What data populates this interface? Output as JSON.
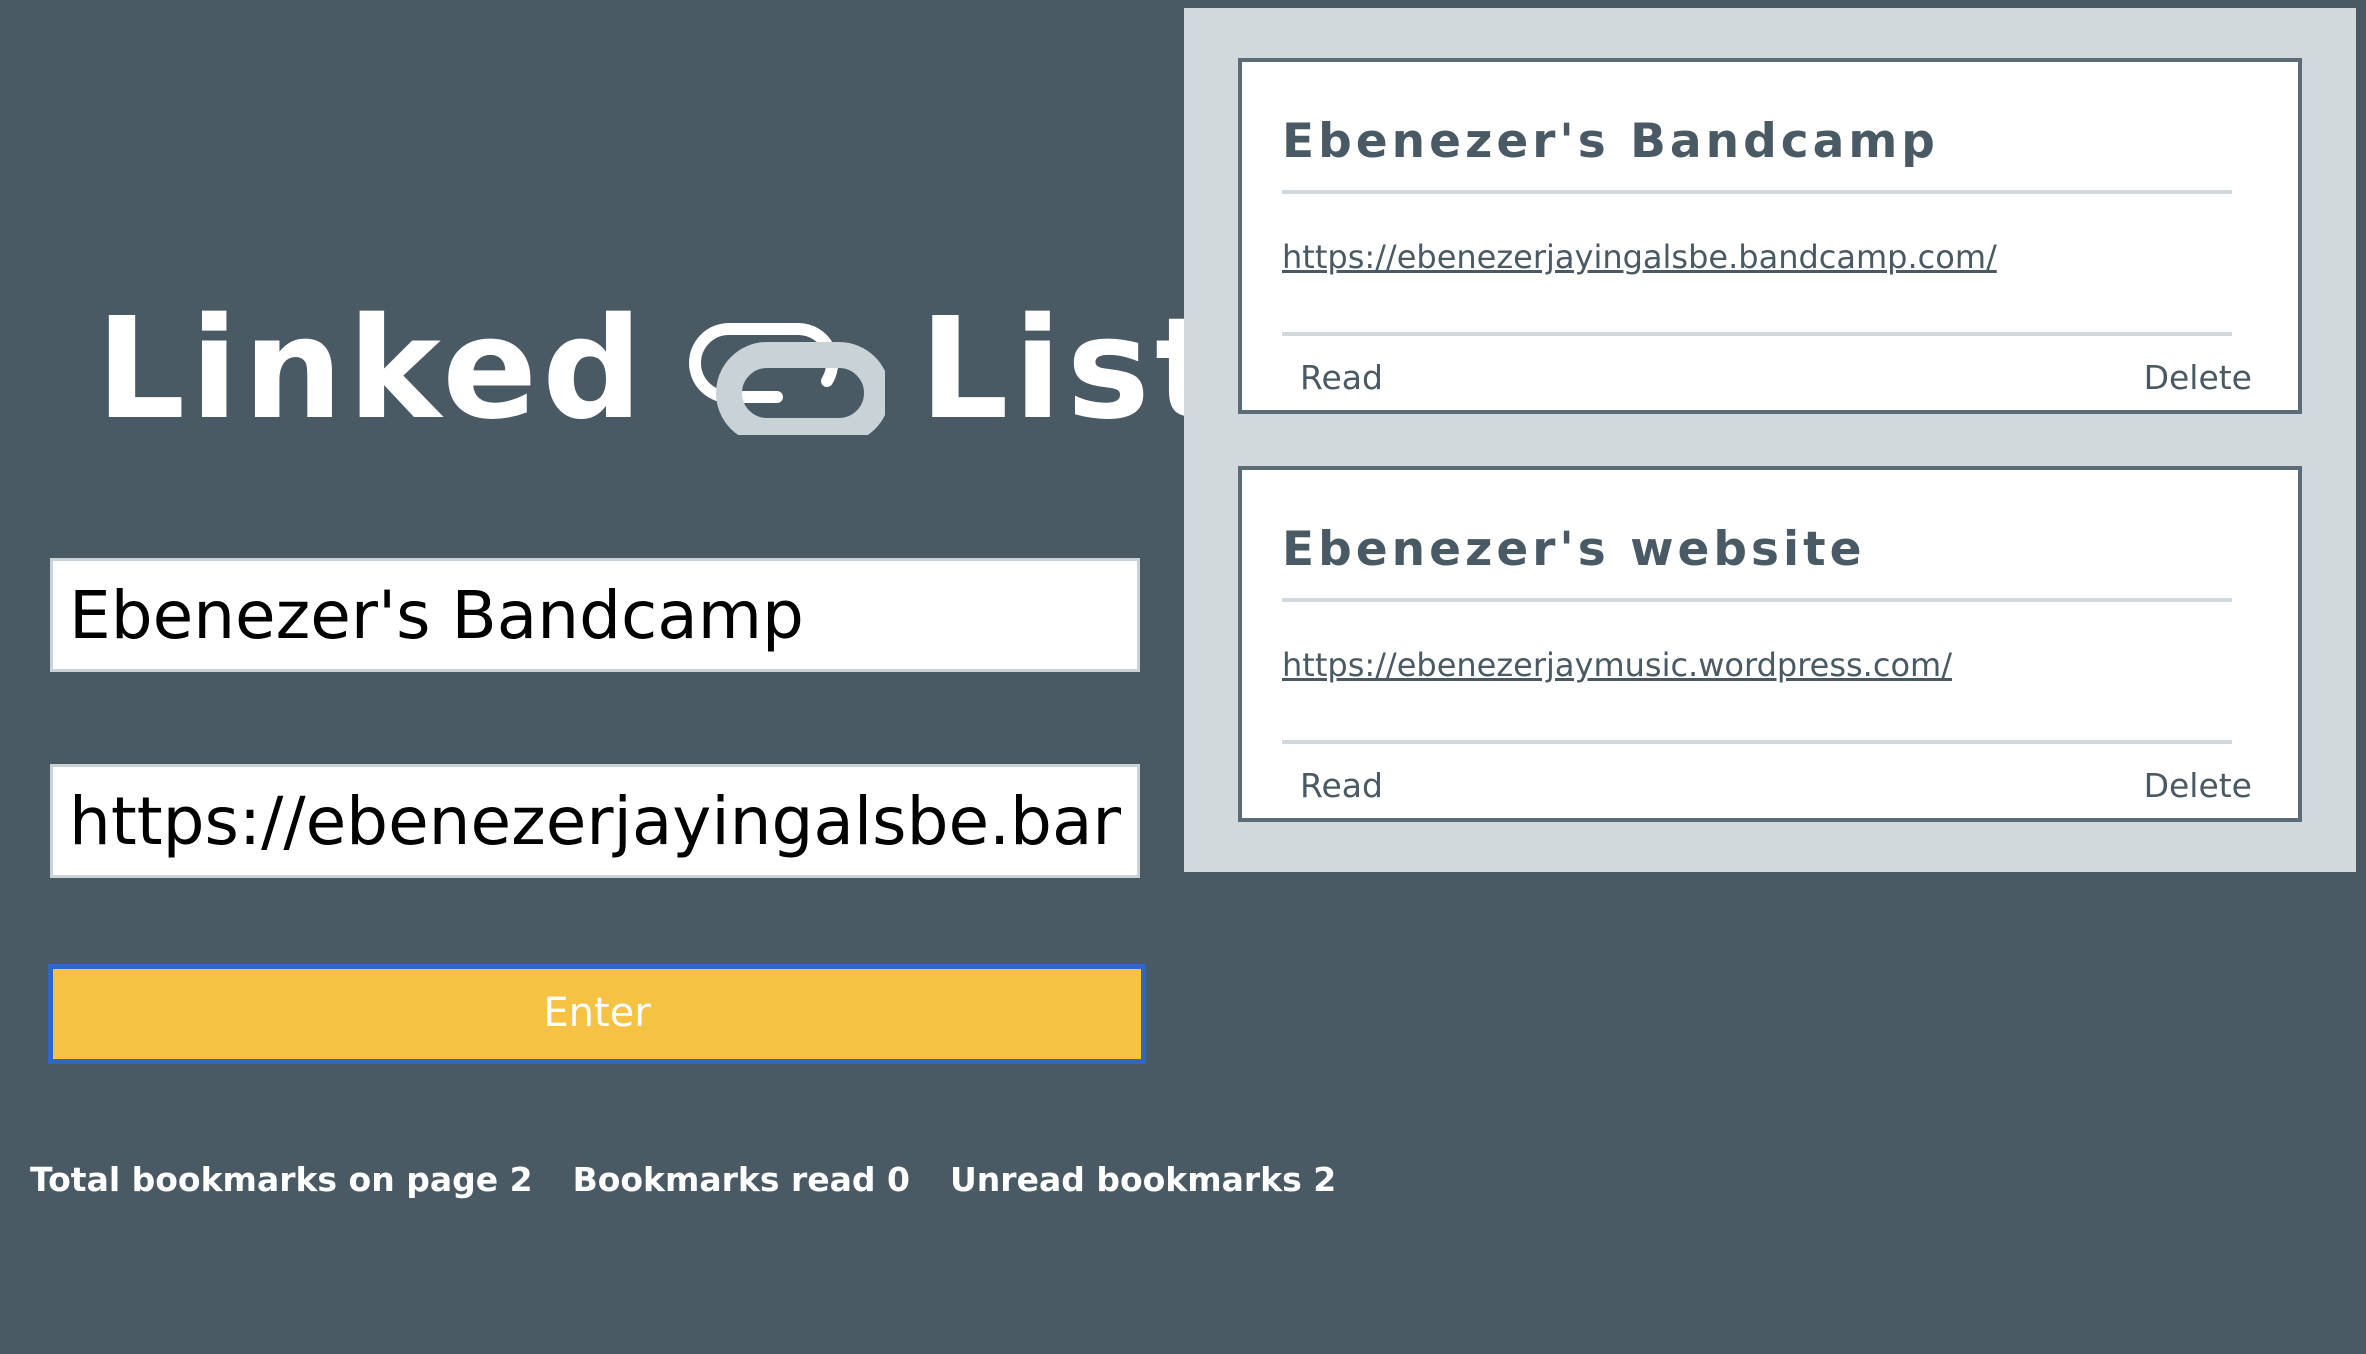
{
  "logo": {
    "word_left": "Linked",
    "word_right": "List",
    "icon": "paperclip-link-icon"
  },
  "form": {
    "title_value": "Ebenezer's Bandcamp",
    "url_value": "https://ebenezerjayingalsbe.bandcamp.com/",
    "enter_label": "Enter"
  },
  "stats": {
    "total_label": "Total bookmarks on page 2",
    "read_label": "Bookmarks read 0",
    "unread_label": "Unread bookmarks 2"
  },
  "bookmarks": [
    {
      "title": "Ebenezer's Bandcamp",
      "url": "https://ebenezerjayingalsbe.bandcamp.com/",
      "read_label": "Read",
      "delete_label": "Delete"
    },
    {
      "title": "Ebenezer's website",
      "url": "https://ebenezerjaymusic.wordpress.com/",
      "read_label": "Read",
      "delete_label": "Delete"
    }
  ],
  "colors": {
    "background": "#4a5a64",
    "panel": "#d1d9dd",
    "button": "#f5c243",
    "focus_ring": "#2f67c7"
  }
}
